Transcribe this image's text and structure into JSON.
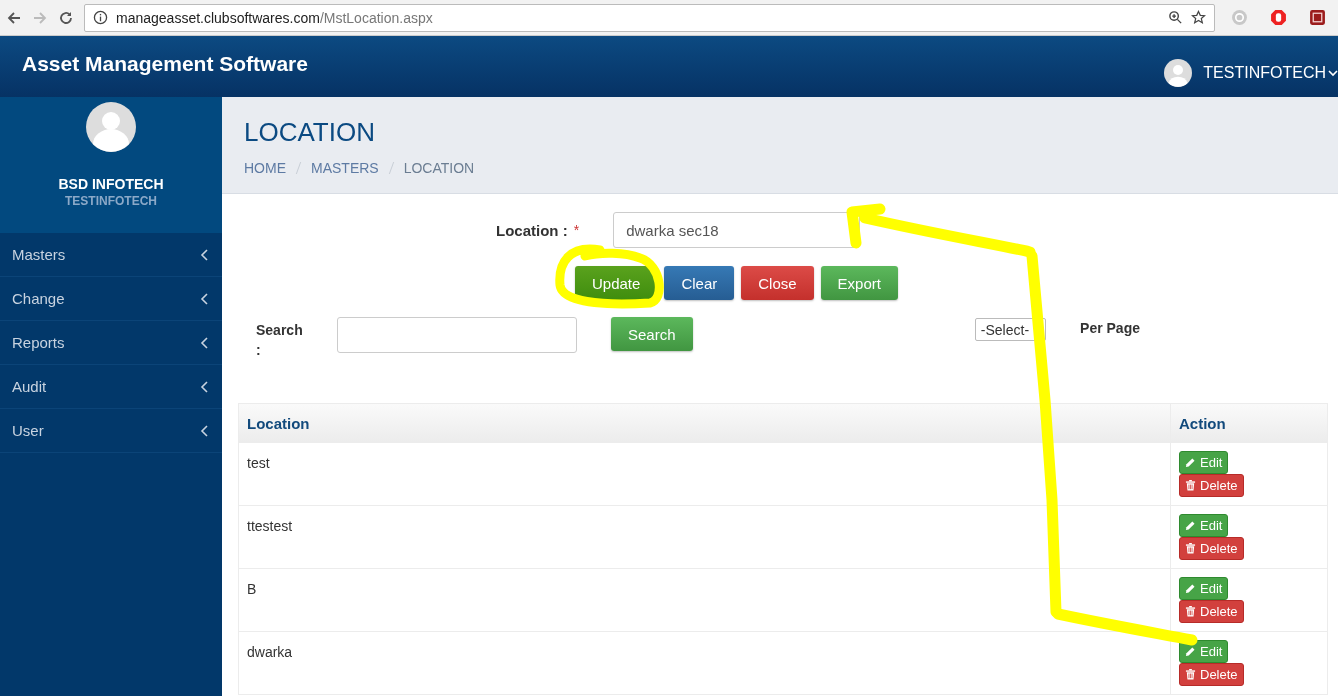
{
  "browser": {
    "url_host": "manageasset.clubsoftwares.com",
    "url_path": "/MstLocation.aspx"
  },
  "header": {
    "app_title": "Asset Management Software",
    "user_name": "TESTINFOTECH"
  },
  "sidebar": {
    "company": "BSD INFOTECH",
    "user": "TESTINFOTECH",
    "items": [
      {
        "label": "Masters",
        "expanded": false
      },
      {
        "label": "Change",
        "expanded": false
      },
      {
        "label": "Reports",
        "expanded": false
      },
      {
        "label": "Audit",
        "expanded": false
      },
      {
        "label": "User",
        "expanded": false
      }
    ]
  },
  "page": {
    "title": "LOCATION",
    "breadcrumb": [
      "HOME",
      "MASTERS",
      "LOCATION"
    ]
  },
  "form": {
    "label": "Location :",
    "required_mark": "*",
    "value": "dwarka sec18",
    "buttons": [
      {
        "label": "Update",
        "kind": "update"
      },
      {
        "label": "Clear",
        "kind": "clear"
      },
      {
        "label": "Close",
        "kind": "close"
      },
      {
        "label": "Export",
        "kind": "export"
      }
    ]
  },
  "search": {
    "label": "Search :",
    "button": "Search",
    "page_size": "-Select-",
    "page_size_label": "Per Page"
  },
  "table": {
    "columns": [
      "Location",
      "Action"
    ],
    "rows": [
      {
        "location": "test",
        "edit": "Edit",
        "delete": "Delete"
      },
      {
        "location": "ttestest",
        "edit": "Edit",
        "delete": "Delete"
      },
      {
        "location": "B",
        "edit": "Edit",
        "delete": "Delete"
      },
      {
        "location": "dwarka",
        "edit": "Edit",
        "delete": "Delete"
      }
    ]
  },
  "annotation": {
    "kind": "highlight-arrow"
  }
}
